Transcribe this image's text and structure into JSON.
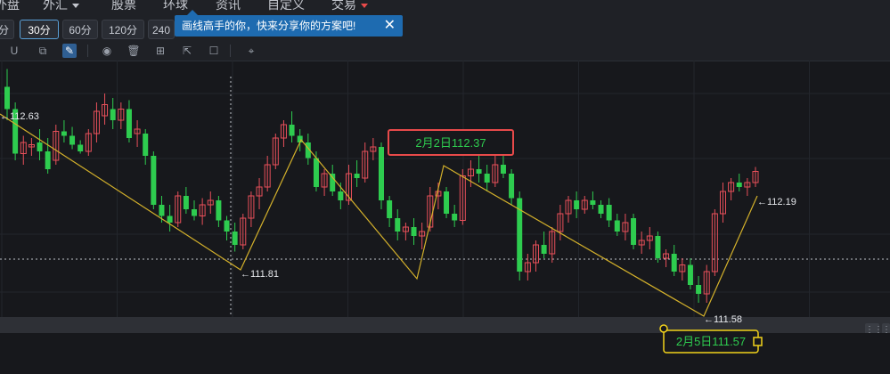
{
  "menu": {
    "items": [
      {
        "label": "外盘",
        "caret": false
      },
      {
        "label": "外汇",
        "caret": true
      },
      {
        "label": "股票",
        "caret": false
      },
      {
        "label": "环球",
        "caret": false
      },
      {
        "label": "资讯",
        "caret": false
      },
      {
        "label": "自定义",
        "caret": false
      },
      {
        "label": "交易",
        "caret": true
      }
    ]
  },
  "timeframes": [
    {
      "label": "分",
      "active": false
    },
    {
      "label": "30分",
      "active": true
    },
    {
      "label": "60分",
      "active": false
    },
    {
      "label": "120分",
      "active": false
    },
    {
      "label": "240",
      "active": false
    }
  ],
  "tooltip": {
    "text": "画线高手的你，快来分享你的方案吧!",
    "close": "✕"
  },
  "tools": [
    "magnet-icon",
    "layers-icon",
    "pencil-icon",
    "eye-icon",
    "trash-icon",
    "group-icon",
    "export-icon",
    "comment-icon",
    "ruler-icon"
  ],
  "colors": {
    "up": "#e8505a",
    "down": "#2ecc4f",
    "line": "#d4b12b",
    "label_box_red": "#e84a4a",
    "label_box_yellow": "#f2d21b",
    "bg": "#17181c"
  },
  "chart_data": {
    "type": "candlestick",
    "y_axis": {
      "min": 111.5,
      "max": 112.7
    },
    "price_labels": {
      "p1": "112.63",
      "p2": "111.81",
      "p3": "112.19",
      "p4": "111.58"
    },
    "annotation_top": "2月2日112.37",
    "annotation_bottom": "2月5日111.57",
    "candles": [
      [
        112.55,
        112.63,
        112.4,
        112.45
      ],
      [
        112.45,
        112.48,
        112.22,
        112.25
      ],
      [
        112.25,
        112.33,
        112.2,
        112.3
      ],
      [
        112.28,
        112.32,
        112.24,
        112.29
      ],
      [
        112.3,
        112.36,
        112.22,
        112.26
      ],
      [
        112.26,
        112.32,
        112.16,
        112.18
      ],
      [
        112.22,
        112.38,
        112.2,
        112.35
      ],
      [
        112.35,
        112.4,
        112.3,
        112.33
      ],
      [
        112.33,
        112.37,
        112.27,
        112.29
      ],
      [
        112.29,
        112.31,
        112.25,
        112.26
      ],
      [
        112.26,
        112.36,
        112.24,
        112.34
      ],
      [
        112.34,
        112.48,
        112.3,
        112.44
      ],
      [
        112.42,
        112.52,
        112.38,
        112.47
      ],
      [
        112.45,
        112.5,
        112.36,
        112.4
      ],
      [
        112.4,
        112.48,
        112.36,
        112.45
      ],
      [
        112.45,
        112.49,
        112.3,
        112.32
      ],
      [
        112.34,
        112.4,
        112.28,
        112.36
      ],
      [
        112.34,
        112.36,
        112.2,
        112.24
      ],
      [
        112.24,
        112.26,
        112.0,
        112.02
      ],
      [
        112.02,
        112.06,
        111.94,
        111.97
      ],
      [
        111.97,
        112.02,
        111.9,
        111.94
      ],
      [
        111.94,
        112.08,
        111.92,
        112.06
      ],
      [
        112.06,
        112.1,
        111.98,
        112.0
      ],
      [
        112.0,
        112.04,
        111.95,
        111.97
      ],
      [
        111.97,
        112.05,
        111.93,
        112.02
      ],
      [
        112.02,
        112.08,
        111.98,
        112.04
      ],
      [
        112.04,
        112.06,
        111.92,
        111.95
      ],
      [
        111.95,
        111.97,
        111.86,
        111.9
      ],
      [
        111.9,
        111.94,
        111.81,
        111.84
      ],
      [
        111.84,
        111.98,
        111.82,
        111.96
      ],
      [
        111.96,
        112.08,
        111.92,
        112.06
      ],
      [
        112.06,
        112.14,
        112.0,
        112.1
      ],
      [
        112.1,
        112.24,
        112.08,
        112.2
      ],
      [
        112.2,
        112.34,
        112.18,
        112.32
      ],
      [
        112.32,
        112.4,
        112.28,
        112.38
      ],
      [
        112.38,
        112.44,
        112.3,
        112.33
      ],
      [
        112.33,
        112.36,
        112.26,
        112.3
      ],
      [
        112.3,
        112.34,
        112.2,
        112.23
      ],
      [
        112.23,
        112.26,
        112.08,
        112.1
      ],
      [
        112.1,
        112.18,
        112.06,
        112.16
      ],
      [
        112.16,
        112.2,
        112.06,
        112.08
      ],
      [
        112.08,
        112.12,
        112.0,
        112.04
      ],
      [
        112.04,
        112.2,
        112.02,
        112.16
      ],
      [
        112.16,
        112.22,
        112.1,
        112.14
      ],
      [
        112.14,
        112.3,
        112.12,
        112.26
      ],
      [
        112.26,
        112.32,
        112.22,
        112.28
      ],
      [
        112.28,
        112.3,
        112.0,
        112.04
      ],
      [
        112.04,
        112.06,
        111.92,
        111.96
      ],
      [
        111.96,
        112.0,
        111.86,
        111.9
      ],
      [
        111.9,
        111.94,
        111.86,
        111.92
      ],
      [
        111.92,
        111.96,
        111.84,
        111.88
      ],
      [
        111.88,
        111.94,
        111.82,
        111.9
      ],
      [
        111.92,
        112.1,
        111.9,
        112.06
      ],
      [
        112.06,
        112.12,
        112.0,
        112.08
      ],
      [
        112.08,
        112.1,
        111.96,
        111.98
      ],
      [
        111.98,
        112.02,
        111.92,
        111.95
      ],
      [
        111.95,
        112.18,
        111.93,
        112.15
      ],
      [
        112.15,
        112.22,
        112.1,
        112.18
      ],
      [
        112.18,
        112.24,
        112.12,
        112.16
      ],
      [
        112.16,
        112.2,
        112.08,
        112.12
      ],
      [
        112.12,
        112.24,
        112.1,
        112.2
      ],
      [
        112.2,
        112.24,
        112.14,
        112.16
      ],
      [
        112.16,
        112.18,
        112.02,
        112.05
      ],
      [
        112.05,
        112.08,
        111.68,
        111.72
      ],
      [
        111.72,
        111.8,
        111.68,
        111.76
      ],
      [
        111.76,
        111.86,
        111.72,
        111.84
      ],
      [
        111.84,
        111.9,
        111.78,
        111.8
      ],
      [
        111.8,
        111.92,
        111.76,
        111.9
      ],
      [
        111.9,
        112.02,
        111.86,
        111.98
      ],
      [
        111.98,
        112.06,
        111.94,
        112.04
      ],
      [
        112.04,
        112.08,
        111.96,
        112.0
      ],
      [
        112.0,
        112.06,
        111.98,
        112.04
      ],
      [
        112.04,
        112.08,
        112.0,
        112.02
      ],
      [
        112.02,
        112.04,
        111.96,
        111.98
      ],
      [
        112.02,
        112.05,
        111.92,
        111.95
      ],
      [
        111.95,
        111.98,
        111.88,
        111.9
      ],
      [
        111.9,
        111.98,
        111.86,
        111.94
      ],
      [
        111.96,
        111.98,
        111.82,
        111.84
      ],
      [
        111.84,
        111.9,
        111.8,
        111.86
      ],
      [
        111.86,
        111.92,
        111.82,
        111.88
      ],
      [
        111.88,
        111.9,
        111.76,
        111.78
      ],
      [
        111.78,
        111.82,
        111.74,
        111.8
      ],
      [
        111.8,
        111.84,
        111.7,
        111.72
      ],
      [
        111.72,
        111.78,
        111.68,
        111.75
      ],
      [
        111.75,
        111.78,
        111.64,
        111.66
      ],
      [
        111.66,
        111.7,
        111.58,
        111.62
      ],
      [
        111.62,
        111.75,
        111.58,
        111.72
      ],
      [
        111.72,
        112.0,
        111.7,
        111.98
      ],
      [
        111.98,
        112.12,
        111.94,
        112.08
      ],
      [
        112.08,
        112.14,
        112.04,
        112.12
      ],
      [
        112.12,
        112.16,
        112.08,
        112.1
      ],
      [
        112.1,
        112.14,
        112.06,
        112.12
      ],
      [
        112.12,
        112.19,
        112.1,
        112.17
      ]
    ]
  }
}
